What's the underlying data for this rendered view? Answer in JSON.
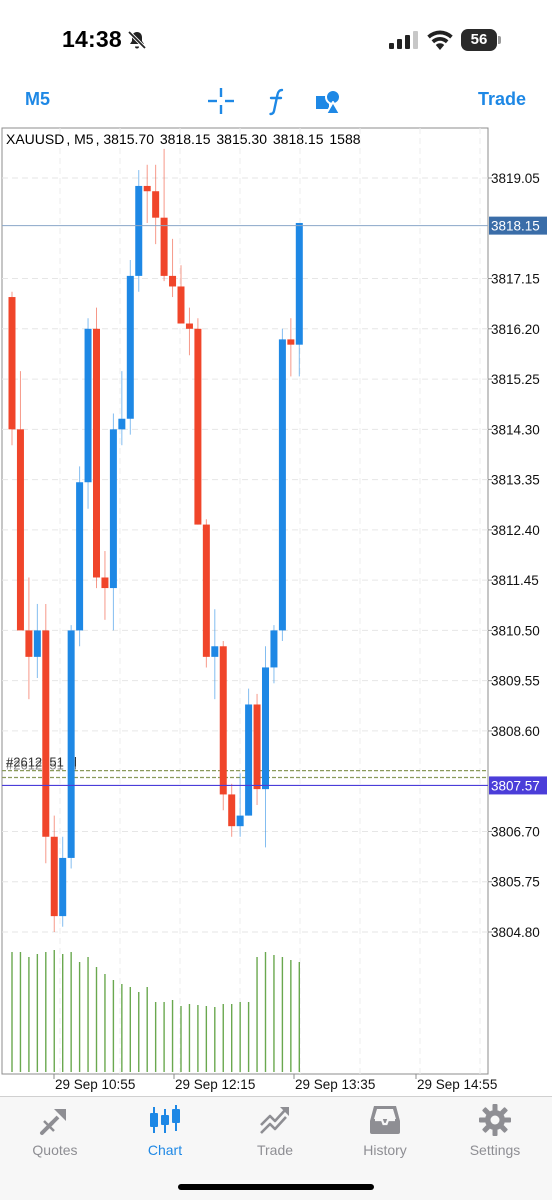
{
  "status_bar": {
    "time": "14:38",
    "battery_level": "56",
    "icons": [
      "bell-slash-icon",
      "cellular-signal-icon",
      "wifi-icon",
      "battery-icon"
    ]
  },
  "toolbar": {
    "timeframe_label": "M5",
    "trade_label": "Trade",
    "icons": [
      "crosshair-icon",
      "function-icon",
      "objects-icon"
    ],
    "accent_color": "#1e88e5"
  },
  "chart": {
    "symbol": "XAUUSD",
    "period": "M5",
    "open": "3815.70",
    "high": "3818.15",
    "low": "3815.30",
    "close": "3818.15",
    "volume": "1588",
    "price_labels": [
      "3819.05",
      "3817.15",
      "3816.20",
      "3815.25",
      "3814.30",
      "3813.35",
      "3812.40",
      "3811.45",
      "3810.50",
      "3809.55",
      "3808.60",
      "3806.70",
      "3805.75",
      "3804.80"
    ],
    "bid_tag": "3818.15",
    "ask_tag": "3807.57",
    "time_labels": [
      "29 Sep 10:55",
      "29 Sep 12:15",
      "29 Sep 13:35",
      "29 Sep 14:55"
    ],
    "order_label": "#2612851 sl",
    "colors": {
      "bull": "#1e88e5",
      "bear": "#f0452a",
      "volume": "#6aa84f",
      "bid_line": "#8aa6c8",
      "ask_line": "#4b3dd9",
      "order_line": "#8a9a5b"
    }
  },
  "chart_data": {
    "type": "candlestick",
    "title": "",
    "x": [
      "29 Sep 10:55",
      "29 Sep 12:15",
      "29 Sep 13:35",
      "29 Sep 14:55"
    ],
    "ylim": [
      3804.0,
      3819.9
    ],
    "grid": true,
    "candles": [
      [
        3816.8,
        3816.9,
        3814.0,
        3814.3
      ],
      [
        3814.3,
        3815.4,
        3810.6,
        3810.5
      ],
      [
        3810.5,
        3811.5,
        3809.2,
        3810.0
      ],
      [
        3810.0,
        3811.0,
        3809.6,
        3810.5
      ],
      [
        3810.5,
        3811.0,
        3806.1,
        3806.6
      ],
      [
        3806.6,
        3807.0,
        3804.8,
        3805.1
      ],
      [
        3805.1,
        3806.6,
        3804.9,
        3806.2
      ],
      [
        3806.2,
        3810.6,
        3806.0,
        3810.5
      ],
      [
        3810.5,
        3813.6,
        3810.2,
        3813.3
      ],
      [
        3813.3,
        3816.4,
        3812.8,
        3816.2
      ],
      [
        3816.2,
        3816.6,
        3811.3,
        3811.5
      ],
      [
        3811.5,
        3812.0,
        3810.7,
        3811.3
      ],
      [
        3811.3,
        3814.6,
        3810.5,
        3814.3
      ],
      [
        3814.3,
        3815.4,
        3814.0,
        3814.5
      ],
      [
        3814.5,
        3817.5,
        3814.2,
        3817.2
      ],
      [
        3817.2,
        3819.2,
        3816.9,
        3818.9
      ],
      [
        3818.9,
        3819.3,
        3818.2,
        3818.8
      ],
      [
        3818.8,
        3819.3,
        3817.8,
        3818.3
      ],
      [
        3818.3,
        3819.6,
        3817.1,
        3817.2
      ],
      [
        3817.2,
        3817.9,
        3816.8,
        3817.0
      ],
      [
        3817.0,
        3817.4,
        3816.3,
        3816.3
      ],
      [
        3816.3,
        3816.6,
        3815.7,
        3816.2
      ],
      [
        3816.2,
        3816.4,
        3812.5,
        3812.5
      ],
      [
        3812.5,
        3812.6,
        3809.8,
        3810.0
      ],
      [
        3810.0,
        3810.9,
        3809.2,
        3810.2
      ],
      [
        3810.2,
        3810.3,
        3807.1,
        3807.4
      ],
      [
        3807.4,
        3807.6,
        3806.6,
        3806.8
      ],
      [
        3806.8,
        3807.8,
        3806.6,
        3807.0
      ],
      [
        3807.0,
        3809.4,
        3807.0,
        3809.1
      ],
      [
        3809.1,
        3809.3,
        3807.2,
        3807.5
      ],
      [
        3807.5,
        3810.2,
        3806.4,
        3809.8
      ],
      [
        3809.8,
        3810.6,
        3809.5,
        3810.5
      ],
      [
        3810.5,
        3816.2,
        3810.3,
        3816.0
      ],
      [
        3816.0,
        3816.4,
        3815.3,
        3815.9
      ],
      [
        3815.9,
        3818.2,
        3815.3,
        3818.2
      ]
    ],
    "volumes": [
      120,
      120,
      115,
      118,
      120,
      122,
      118,
      120,
      110,
      115,
      105,
      98,
      92,
      88,
      85,
      80,
      85,
      70,
      70,
      72,
      66,
      68,
      67,
      66,
      65,
      68,
      68,
      70,
      70,
      115,
      120,
      117,
      115,
      112,
      110
    ],
    "bid": 3818.15,
    "ask": 3807.57,
    "order_levels": [
      3807.85,
      3807.72
    ]
  },
  "tab_bar": {
    "tabs": [
      {
        "label": "Quotes",
        "icon": "quotes-icon"
      },
      {
        "label": "Chart",
        "icon": "candlestick-chart-icon"
      },
      {
        "label": "Trade",
        "icon": "trade-icon"
      },
      {
        "label": "History",
        "icon": "inbox-history-icon"
      },
      {
        "label": "Settings",
        "icon": "gear-icon"
      }
    ],
    "active_index": 1
  }
}
